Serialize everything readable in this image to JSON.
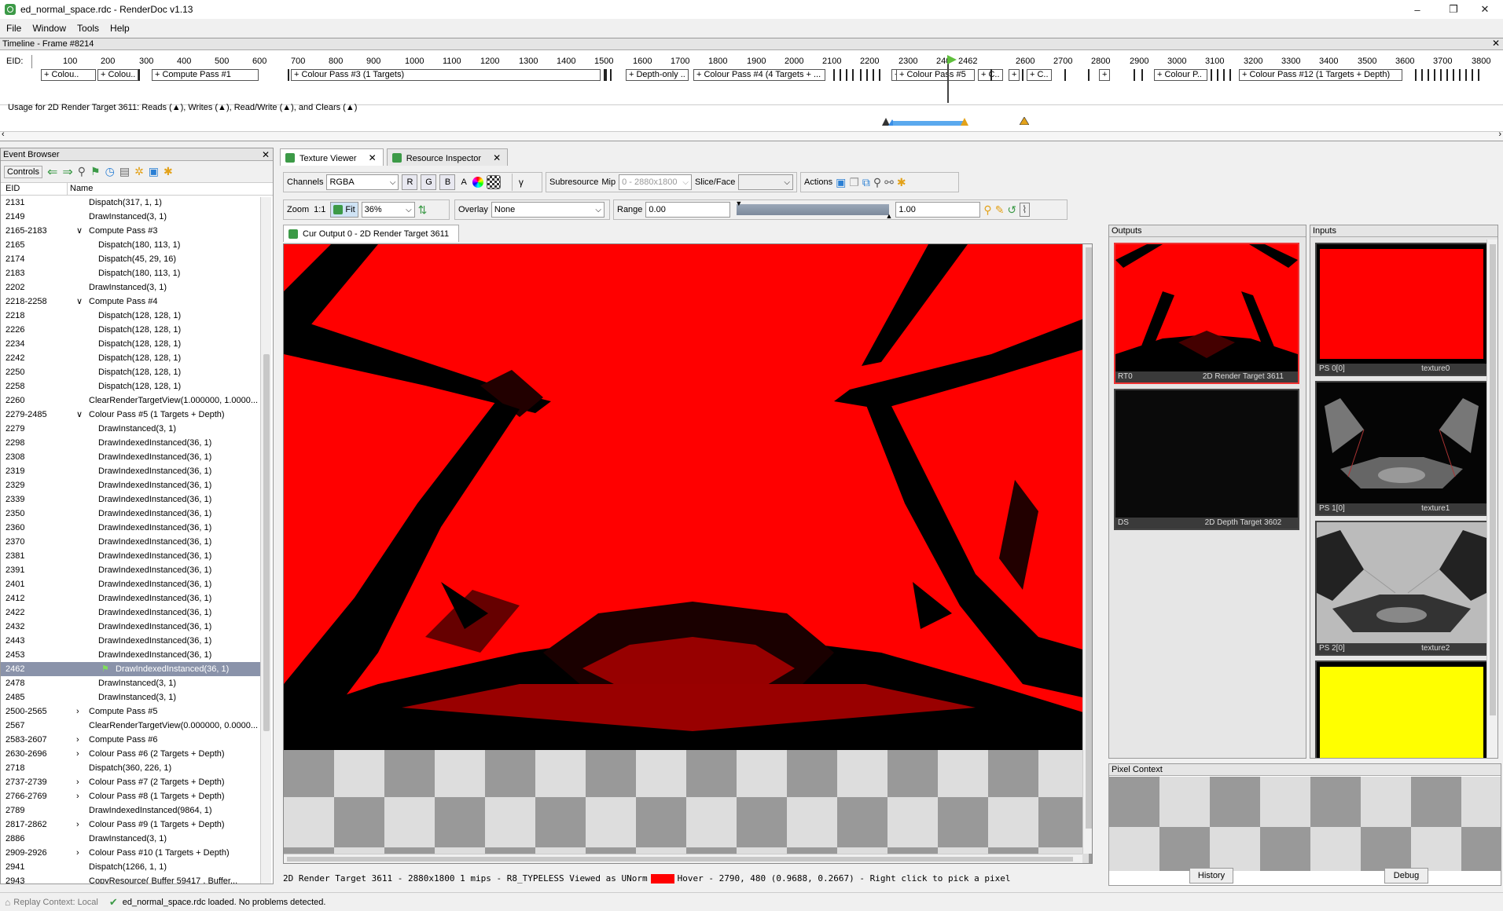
{
  "window": {
    "title": "ed_normal_space.rdc - RenderDoc v1.13",
    "minimize": "–",
    "maximize": "❐",
    "close": "✕"
  },
  "menu": [
    "File",
    "Window",
    "Tools",
    "Help"
  ],
  "timeline": {
    "header": "Timeline - Frame #8214",
    "eid_label": "EID:",
    "ticks": [
      "100",
      "200",
      "300",
      "400",
      "500",
      "600",
      "700",
      "800",
      "900",
      "1000",
      "1100",
      "1200",
      "1300",
      "1400",
      "1500",
      "1600",
      "1700",
      "1800",
      "1900",
      "2000",
      "2100",
      "2200",
      "2300",
      "240",
      "2462",
      "2600",
      "2700",
      "2800",
      "2900",
      "3000",
      "3100",
      "3200",
      "3300",
      "3400",
      "3500",
      "3600",
      "3700",
      "3800"
    ],
    "current_eid": "2462",
    "passes": [
      "+ Colou..",
      "+ Colou..",
      "+ Compute Pass #1",
      "+ Colour Pass #3 (1 Targets)",
      "+ Depth-only ..",
      "+ Colour Pass #4 (4 Targets + ...",
      "+",
      "+ Colour Pass #5",
      "+ C..",
      "+",
      "+ C..",
      "+",
      "+ Colour P..",
      "+ Colour Pass #12 (1 Targets + Depth)"
    ],
    "usage_text": "Usage for 2D Render Target 3611: Reads (▲), Writes (▲), Read/Write (▲), and Clears (▲)"
  },
  "event_browser": {
    "title": "Event Browser",
    "controls_label": "Controls",
    "col_eid": "EID",
    "col_name": "Name",
    "rows": [
      {
        "eid": "2131",
        "name": "Dispatch(317, 1, 1)",
        "indent": 1,
        "chev": ""
      },
      {
        "eid": "2149",
        "name": "DrawInstanced(3, 1)",
        "indent": 1,
        "chev": ""
      },
      {
        "eid": "2165-2183",
        "name": "Compute Pass #3",
        "indent": 0,
        "chev": "∨"
      },
      {
        "eid": "2165",
        "name": "Dispatch(180, 113, 1)",
        "indent": 2,
        "chev": ""
      },
      {
        "eid": "2174",
        "name": "Dispatch(45, 29, 16)",
        "indent": 2,
        "chev": ""
      },
      {
        "eid": "2183",
        "name": "Dispatch(180, 113, 1)",
        "indent": 2,
        "chev": ""
      },
      {
        "eid": "2202",
        "name": "DrawInstanced(3, 1)",
        "indent": 1,
        "chev": ""
      },
      {
        "eid": "2218-2258",
        "name": "Compute Pass #4",
        "indent": 0,
        "chev": "∨"
      },
      {
        "eid": "2218",
        "name": "Dispatch(128, 128, 1)",
        "indent": 2,
        "chev": ""
      },
      {
        "eid": "2226",
        "name": "Dispatch(128, 128, 1)",
        "indent": 2,
        "chev": ""
      },
      {
        "eid": "2234",
        "name": "Dispatch(128, 128, 1)",
        "indent": 2,
        "chev": ""
      },
      {
        "eid": "2242",
        "name": "Dispatch(128, 128, 1)",
        "indent": 2,
        "chev": ""
      },
      {
        "eid": "2250",
        "name": "Dispatch(128, 128, 1)",
        "indent": 2,
        "chev": ""
      },
      {
        "eid": "2258",
        "name": "Dispatch(128, 128, 1)",
        "indent": 2,
        "chev": ""
      },
      {
        "eid": "2260",
        "name": "ClearRenderTargetView(1.000000, 1.0000...",
        "indent": 1,
        "chev": ""
      },
      {
        "eid": "2279-2485",
        "name": "Colour Pass #5 (1 Targets + Depth)",
        "indent": 0,
        "chev": "∨"
      },
      {
        "eid": "2279",
        "name": "DrawInstanced(3, 1)",
        "indent": 2,
        "chev": ""
      },
      {
        "eid": "2298",
        "name": "DrawIndexedInstanced(36, 1)",
        "indent": 2,
        "chev": ""
      },
      {
        "eid": "2308",
        "name": "DrawIndexedInstanced(36, 1)",
        "indent": 2,
        "chev": ""
      },
      {
        "eid": "2319",
        "name": "DrawIndexedInstanced(36, 1)",
        "indent": 2,
        "chev": ""
      },
      {
        "eid": "2329",
        "name": "DrawIndexedInstanced(36, 1)",
        "indent": 2,
        "chev": ""
      },
      {
        "eid": "2339",
        "name": "DrawIndexedInstanced(36, 1)",
        "indent": 2,
        "chev": ""
      },
      {
        "eid": "2350",
        "name": "DrawIndexedInstanced(36, 1)",
        "indent": 2,
        "chev": ""
      },
      {
        "eid": "2360",
        "name": "DrawIndexedInstanced(36, 1)",
        "indent": 2,
        "chev": ""
      },
      {
        "eid": "2370",
        "name": "DrawIndexedInstanced(36, 1)",
        "indent": 2,
        "chev": ""
      },
      {
        "eid": "2381",
        "name": "DrawIndexedInstanced(36, 1)",
        "indent": 2,
        "chev": ""
      },
      {
        "eid": "2391",
        "name": "DrawIndexedInstanced(36, 1)",
        "indent": 2,
        "chev": ""
      },
      {
        "eid": "2401",
        "name": "DrawIndexedInstanced(36, 1)",
        "indent": 2,
        "chev": ""
      },
      {
        "eid": "2412",
        "name": "DrawIndexedInstanced(36, 1)",
        "indent": 2,
        "chev": ""
      },
      {
        "eid": "2422",
        "name": "DrawIndexedInstanced(36, 1)",
        "indent": 2,
        "chev": ""
      },
      {
        "eid": "2432",
        "name": "DrawIndexedInstanced(36, 1)",
        "indent": 2,
        "chev": ""
      },
      {
        "eid": "2443",
        "name": "DrawIndexedInstanced(36, 1)",
        "indent": 2,
        "chev": ""
      },
      {
        "eid": "2453",
        "name": "DrawIndexedInstanced(36, 1)",
        "indent": 2,
        "chev": ""
      },
      {
        "eid": "2462",
        "name": "DrawIndexedInstanced(36, 1)",
        "indent": 3,
        "chev": "",
        "selected": true
      },
      {
        "eid": "2478",
        "name": "DrawInstanced(3, 1)",
        "indent": 2,
        "chev": ""
      },
      {
        "eid": "2485",
        "name": "DrawInstanced(3, 1)",
        "indent": 2,
        "chev": ""
      },
      {
        "eid": "2500-2565",
        "name": "Compute Pass #5",
        "indent": 0,
        "chev": "›"
      },
      {
        "eid": "2567",
        "name": "ClearRenderTargetView(0.000000, 0.0000...",
        "indent": 1,
        "chev": ""
      },
      {
        "eid": "2583-2607",
        "name": "Compute Pass #6",
        "indent": 0,
        "chev": "›"
      },
      {
        "eid": "2630-2696",
        "name": "Colour Pass #6 (2 Targets + Depth)",
        "indent": 0,
        "chev": "›"
      },
      {
        "eid": "2718",
        "name": "Dispatch(360, 226, 1)",
        "indent": 1,
        "chev": ""
      },
      {
        "eid": "2737-2739",
        "name": "Colour Pass #7 (2 Targets + Depth)",
        "indent": 0,
        "chev": "›"
      },
      {
        "eid": "2766-2769",
        "name": "Colour Pass #8 (1 Targets + Depth)",
        "indent": 0,
        "chev": "›"
      },
      {
        "eid": "2789",
        "name": "DrawIndexedInstanced(9864, 1)",
        "indent": 1,
        "chev": ""
      },
      {
        "eid": "2817-2862",
        "name": "Colour Pass #9 (1 Targets + Depth)",
        "indent": 0,
        "chev": "›"
      },
      {
        "eid": "2886",
        "name": "DrawInstanced(3, 1)",
        "indent": 1,
        "chev": ""
      },
      {
        "eid": "2909-2926",
        "name": "Colour Pass #10 (1 Targets + Depth)",
        "indent": 0,
        "chev": "›"
      },
      {
        "eid": "2941",
        "name": "Dispatch(1266, 1, 1)",
        "indent": 1,
        "chev": ""
      },
      {
        "eid": "2943",
        "name": "CopyResource( Buffer 59417 , Buffer...",
        "indent": 1,
        "chev": ""
      }
    ]
  },
  "tabs": {
    "texture_viewer": "Texture Viewer",
    "resource_inspector": "Resource Inspector",
    "close": "✕"
  },
  "toolbar1": {
    "channels_label": "Channels",
    "channels_value": "RGBA",
    "r": "R",
    "g": "G",
    "b": "B",
    "a": "A",
    "gamma": "γ",
    "subresource_label": "Subresource",
    "mip_label": "Mip",
    "mip_value": "0 - 2880x1800",
    "slice_label": "Slice/Face",
    "slice_value": "",
    "actions_label": "Actions"
  },
  "toolbar2": {
    "zoom_label": "Zoom",
    "one_to_one": "1:1",
    "fit": "Fit",
    "zoom_value": "36%",
    "overlay_label": "Overlay",
    "overlay_value": "None",
    "range_label": "Range",
    "range_min": "0.00",
    "range_max": "1.00"
  },
  "output_tab": "Cur Output 0 - 2D Render Target 3611",
  "outputs": {
    "header": "Outputs",
    "items": [
      {
        "slot": "RT0",
        "name": "2D Render Target 3611"
      },
      {
        "slot": "DS",
        "name": "2D Depth Target 3602"
      }
    ]
  },
  "inputs": {
    "header": "Inputs",
    "items": [
      {
        "slot": "PS 0[0]",
        "name": "texture0"
      },
      {
        "slot": "PS 1[0]",
        "name": "texture1"
      },
      {
        "slot": "PS 2[0]",
        "name": "texture2"
      },
      {
        "slot": "",
        "name": ""
      }
    ]
  },
  "pixel_context": {
    "header": "Pixel Context",
    "history": "History",
    "debug": "Debug"
  },
  "texture_status": {
    "info": "2D Render Target 3611 - 2880x1800 1 mips - R8_TYPELESS Viewed as UNorm",
    "hover": "Hover -  2790,  480 (0.9688, 0.2667)  - Right click to pick a pixel"
  },
  "status": {
    "replay_context": "Replay Context: Local",
    "message": "ed_normal_space.rdc loaded. No problems detected."
  },
  "colors": {
    "accent_green": "#3c9a47",
    "render_red": "#ff0000",
    "selection": "#8a93aa",
    "yellow_tex": "#ffff00"
  }
}
